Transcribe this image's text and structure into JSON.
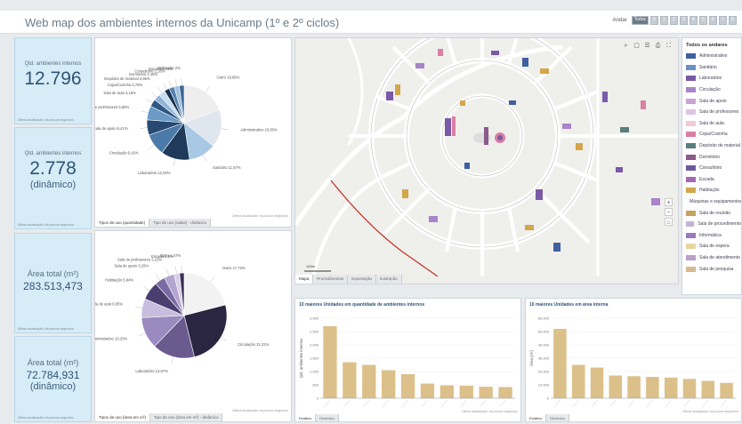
{
  "header": {
    "title": "Web map dos ambientes internos da Unicamp (1º e 2º ciclos)",
    "floor_label": "Andar",
    "floors": [
      "Todos",
      "0",
      "1",
      "2",
      "3",
      "4",
      "5",
      "6",
      "7",
      "8"
    ]
  },
  "kpis": [
    {
      "label": "Qtd. ambientes internos",
      "value": "12.796",
      "sub": "",
      "foot": "Última atualização: há poucos segundos"
    },
    {
      "label": "Qtd. ambientes internos",
      "value": "2.778",
      "sub": "(dinâmico)",
      "foot": "Última atualização: há poucos segundos"
    },
    {
      "label": "Área total (m²)",
      "value": "283.513,473",
      "sub": "",
      "foot": "Última atualização: há poucos segundos"
    },
    {
      "label": "Área total (m²)",
      "value": "72.784,931",
      "sub": "(dinâmico)",
      "foot": "Última atualização: há poucos segundos"
    }
  ],
  "pie_top": {
    "tabs": [
      "Tipos de uso (quantidade)",
      "Tipo de uso (salas) - dinâmico"
    ],
    "updated": "Última atualização: há poucos segundos",
    "labels": [
      "Outro 18,69%",
      "Administrativo 15,83%",
      "Sanitário 11,57%",
      "Laboratório 12,03%",
      "Circulação 9,16%",
      "Sala de apoio 6,41%",
      "Sala de professores 5,85%",
      "Sala de aula 3,16%",
      "Copa/Cozinha 2,79%",
      "Depósito de material 2,66%",
      "Dormitório 2,18%",
      "Consultório 2,18%",
      "Escada 2,17%",
      "Habitação 2%"
    ]
  },
  "pie_bottom": {
    "tabs": [
      "Tipos de uso (área em m²)",
      "Tipo de uso (área em m²) - dinâmico"
    ],
    "updated": "Última atualização: há poucos segundos",
    "labels": [
      "Outro 17,72%",
      "Circulação 21,31%",
      "Laboratório 13,57%",
      "Administrativo 10,20%",
      "Sala de aula 6,05%",
      "Habitação 5,94%",
      "Sala de apoio 3,29%",
      "Sala de professores 3,23%",
      "Escada 1,8%",
      "Outro 1,47%"
    ]
  },
  "map": {
    "tabs": [
      "Mapa",
      "Procedimentos",
      "Exportação",
      "Ilustração"
    ],
    "scale": "100m",
    "legend_title": "Todos os andares",
    "legend": [
      {
        "label": "Administrativo",
        "color": "#3f5fa0"
      },
      {
        "label": "Sanitário",
        "color": "#6a8fc4"
      },
      {
        "label": "Laboratório",
        "color": "#7a5aa6"
      },
      {
        "label": "Circulação",
        "color": "#a984c9"
      },
      {
        "label": "Sala de apoio",
        "color": "#c9a3d6"
      },
      {
        "label": "Sala de professores",
        "color": "#e0c4e3"
      },
      {
        "label": "Sala de aula",
        "color": "#f0c8d8"
      },
      {
        "label": "Copa/Cozinha",
        "color": "#d97fa3"
      },
      {
        "label": "Depósito de material",
        "color": "#5a7f7a"
      },
      {
        "label": "Dormitório",
        "color": "#8a5a8a"
      },
      {
        "label": "Consultório",
        "color": "#6e5a9e"
      },
      {
        "label": "Escada",
        "color": "#a06ab4"
      },
      {
        "label": "Habitação",
        "color": "#d4a64a"
      },
      {
        "label": "Máquinas e equipamentos",
        "color": "#7a8a3a"
      },
      {
        "label": "Sala de reunião",
        "color": "#c8a060"
      },
      {
        "label": "Sala de procedimento",
        "color": "#c3b3d8"
      },
      {
        "label": "Informática",
        "color": "#9a7ac0"
      },
      {
        "label": "Sala de espera",
        "color": "#e8d6a0"
      },
      {
        "label": "Sala de atendimento",
        "color": "#b8a0c8"
      },
      {
        "label": "Sala de pesquisa",
        "color": "#d8b890"
      }
    ]
  },
  "bar_left": {
    "title": "10 maiores Unidades em quantidade de ambientes internos",
    "ylabel": "Qtd. ambientes internos",
    "tabs": [
      "Estático",
      "Dinâmico"
    ],
    "updated": "Última atualização: há poucos segundos"
  },
  "bar_right": {
    "title": "10 maiores Unidades em área interna",
    "ylabel": "Área (m²)",
    "tabs": [
      "Estático",
      "Dinâmico"
    ],
    "updated": "Última atualização: há poucos segundos"
  },
  "chart_data": [
    {
      "type": "pie",
      "labels": [
        "Outro",
        "Administrativo",
        "Sanitário",
        "Laboratório",
        "Circulação",
        "Sala de apoio",
        "Sala de professores",
        "Sala de aula",
        "Copa/Cozinha",
        "Depósito de material",
        "Dormitório",
        "Consultório",
        "Escada",
        "Habitação"
      ],
      "values": [
        18.69,
        15.83,
        11.57,
        12.03,
        9.16,
        6.41,
        5.85,
        3.16,
        2.79,
        2.66,
        2.18,
        2.18,
        2.17,
        2.0
      ]
    },
    {
      "type": "pie",
      "labels": [
        "Outro",
        "Circulação",
        "Laboratório",
        "Administrativo",
        "Sala de aula",
        "Habitação",
        "Sala de apoio",
        "Sala de professores",
        "Escada",
        "Outro"
      ],
      "values": [
        17.72,
        21.31,
        13.57,
        10.2,
        6.05,
        5.94,
        3.29,
        3.23,
        1.8,
        1.47
      ]
    },
    {
      "type": "bar",
      "values": [
        2700,
        1350,
        1250,
        1050,
        900,
        550,
        480,
        470,
        430,
        420
      ],
      "ylim": [
        0,
        3000
      ],
      "ytick_labels": [
        "0",
        "500",
        "1.000",
        "1.500",
        "2.000",
        "2.500",
        "3.000"
      ]
    },
    {
      "type": "bar",
      "values": [
        52000,
        25000,
        23000,
        17000,
        16500,
        16000,
        15500,
        14500,
        13000,
        11500
      ],
      "ylim": [
        0,
        60000
      ],
      "ytick_labels": [
        "0",
        "10.000",
        "20.000",
        "30.000",
        "40.000",
        "50.000",
        "60.000"
      ]
    }
  ]
}
